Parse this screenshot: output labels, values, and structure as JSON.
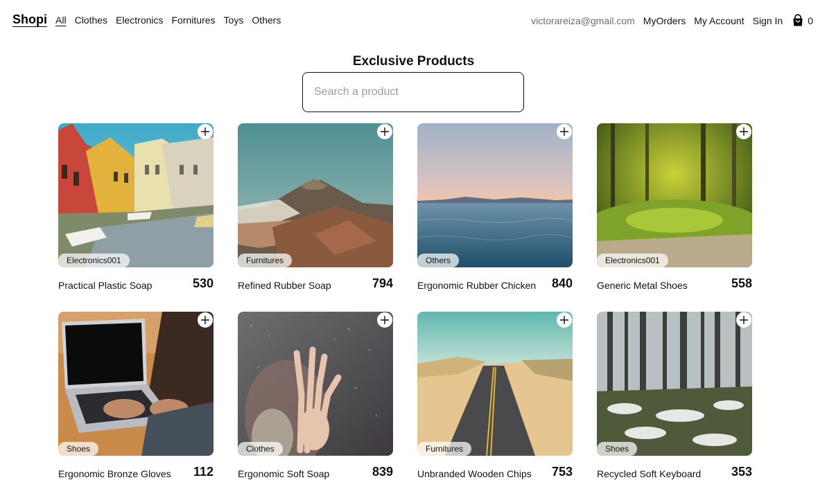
{
  "nav": {
    "brand": "Shopi",
    "categories": [
      "All",
      "Clothes",
      "Electronics",
      "Fornitures",
      "Toys",
      "Others"
    ],
    "email": "victorareiza@gmail.com",
    "my_orders": "MyOrders",
    "my_account": "My Account",
    "sign_in": "Sign In",
    "cart_count": "0",
    "cart_icon": "shopping-bag-icon"
  },
  "header": {
    "title": "Exclusive Products"
  },
  "search": {
    "placeholder": "Search a product",
    "value": ""
  },
  "products": [
    {
      "name": "Practical Plastic Soap",
      "price": "530",
      "category": "Electronics001",
      "image": "canal-town-photo"
    },
    {
      "name": "Refined Rubber Soap",
      "price": "794",
      "category": "Furnitures",
      "image": "volcano-photo"
    },
    {
      "name": "Ergonomic Rubber Chicken",
      "price": "840",
      "category": "Others",
      "image": "sea-sunset-photo"
    },
    {
      "name": "Generic Metal Shoes",
      "price": "558",
      "category": "Electronics001",
      "image": "moss-forest-photo"
    },
    {
      "name": "Ergonomic Bronze Gloves",
      "price": "112",
      "category": "Shoes",
      "image": "laptop-typing-photo"
    },
    {
      "name": "Ergonomic Soft Soap",
      "price": "839",
      "category": "Clothes",
      "image": "rainy-window-hand-photo"
    },
    {
      "name": "Unbranded Wooden Chips",
      "price": "753",
      "category": "Furnitures",
      "image": "desert-road-photo"
    },
    {
      "name": "Recycled Soft Keyboard",
      "price": "353",
      "category": "Shoes",
      "image": "snowy-forest-photo"
    }
  ]
}
